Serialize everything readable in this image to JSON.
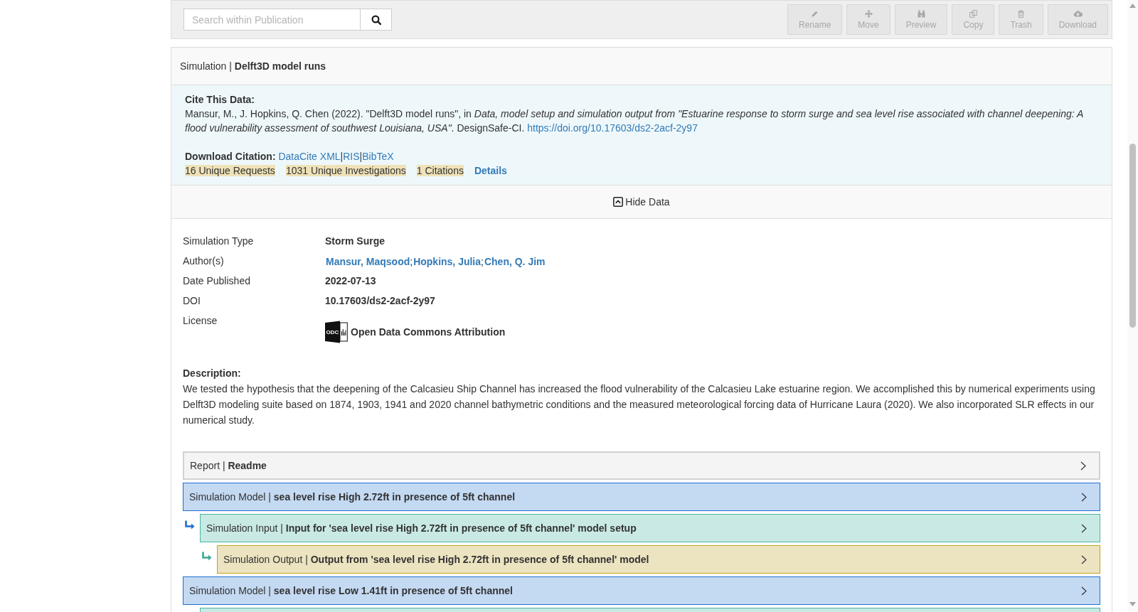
{
  "toolbar": {
    "search": {
      "placeholder": "Search within Publication"
    },
    "actions": [
      {
        "kind": "rename",
        "label": "Rename",
        "disabled": true
      },
      {
        "kind": "move",
        "label": "Move",
        "disabled": true
      },
      {
        "kind": "preview",
        "label": "Preview",
        "disabled": true
      },
      {
        "kind": "copy",
        "label": "Copy",
        "disabled": true
      },
      {
        "kind": "trash",
        "label": "Trash",
        "disabled": true
      },
      {
        "kind": "download",
        "label": "Download",
        "disabled": true
      }
    ]
  },
  "project": {
    "title": "Simulation | **Delft3D model runs**"
  },
  "citation": {
    "heading": "Cite This Data:",
    "text": "Mansur, M., J. Hopkins, Q. Chen (2022). \"Delft3D model runs\", in *Data, model setup and simulation output from \"Estuarine response to storm surge and sea level rise associated with channel deepening: A flood vulnerability assessment of southwest Louisiana, USA\"*. DesignSafe-CI.",
    "doi_link": "https://doi.org/10.17603/ds2-2acf-2y97",
    "download_label": "Download Citation:",
    "formats": [
      "DataCite XML",
      "RIS",
      "BibTeX"
    ],
    "format_separator": "|",
    "metrics": [
      "16 Unique Requests",
      "1031 Unique Investigations",
      "1 Citations"
    ],
    "details_link": "Details"
  },
  "data_toggle": {
    "label": "Hide Data"
  },
  "metadata": [
    {
      "kind": "text",
      "label": "Simulation Type",
      "value": "Storm Surge"
    },
    {
      "kind": "authors",
      "label": "Author(s)",
      "authors": [
        "Mansur, Maqsood",
        "Hopkins, Julia",
        "Chen, Q. Jim"
      ],
      "separator": ";"
    },
    {
      "kind": "text",
      "label": "Date Published",
      "value": "2022-07-13"
    },
    {
      "kind": "text",
      "label": "DOI",
      "value": "10.17603/ds2-2acf-2y97"
    },
    {
      "kind": "license",
      "label": "License",
      "logo_text": "ODC",
      "value": "Open Data Commons Attribution"
    }
  ],
  "description": {
    "heading": "Description:",
    "text": "We tested the hypothesis that the deepening of the Calcasieu Ship Channel has increased the flood vulnerability of the Calcasieu Lake estuarine region. We accomplished this by numerical experiments using Delft3D modeling suite based on 1874, 1903, 1941 and 2020 channel bathymetric conditions and the measured meteorological forcing data of Hurricane Laura (2020). We also incorporated SLR effects in our numerical study."
  },
  "entries": [
    {
      "kind": "report",
      "label": "Report | **Readme**",
      "expanded": false
    },
    {
      "kind": "model",
      "label": "Simulation Model | **sea level rise High 2.72ft in presence of 5ft channel**",
      "expanded": false,
      "children": [
        {
          "kind": "input",
          "label": "Simulation Input | **Input for 'sea level rise High 2.72ft in presence of 5ft channel' model setup**",
          "expanded": false,
          "children": [
            {
              "kind": "output",
              "label": "Simulation Output | **Output from 'sea level rise High 2.72ft in presence of 5ft channel' model**",
              "expanded": false
            }
          ]
        }
      ]
    },
    {
      "kind": "model",
      "label": "Simulation Model | **sea level rise Low 1.41ft in presence of 5ft channel**",
      "expanded": false,
      "children": [
        {
          "kind": "input"
        }
      ]
    }
  ]
}
